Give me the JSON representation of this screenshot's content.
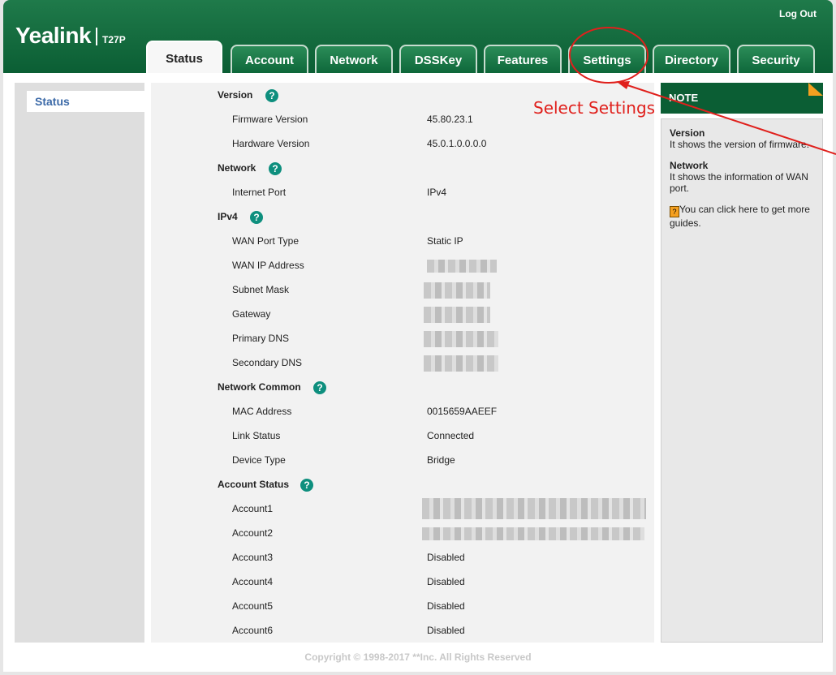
{
  "header": {
    "logout": "Log Out",
    "logo": "Yealink",
    "model": "T27P"
  },
  "tabs": [
    {
      "label": "Status",
      "active": true
    },
    {
      "label": "Account"
    },
    {
      "label": "Network"
    },
    {
      "label": "DSSKey"
    },
    {
      "label": "Features"
    },
    {
      "label": "Settings"
    },
    {
      "label": "Directory"
    },
    {
      "label": "Security"
    }
  ],
  "sidebar": {
    "items": [
      {
        "label": "Status"
      }
    ]
  },
  "main": {
    "version": {
      "title": "Version",
      "firmware_label": "Firmware Version",
      "firmware_value": "45.80.23.1",
      "hardware_label": "Hardware Version",
      "hardware_value": "45.0.1.0.0.0.0"
    },
    "network": {
      "title": "Network",
      "internet_port_label": "Internet Port",
      "internet_port_value": "IPv4"
    },
    "ipv4": {
      "title": "IPv4",
      "wan_type_label": "WAN Port Type",
      "wan_type_value": "Static IP",
      "wan_ip_label": "WAN IP Address",
      "subnet_label": "Subnet Mask",
      "gateway_label": "Gateway",
      "primary_dns_label": "Primary DNS",
      "secondary_dns_label": "Secondary DNS"
    },
    "network_common": {
      "title": "Network Common",
      "mac_label": "MAC Address",
      "mac_value": "0015659AAEEF",
      "link_label": "Link Status",
      "link_value": "Connected",
      "device_label": "Device Type",
      "device_value": "Bridge"
    },
    "account_status": {
      "title": "Account Status",
      "accounts": [
        {
          "label": "Account1",
          "value": ""
        },
        {
          "label": "Account2",
          "value": ""
        },
        {
          "label": "Account3",
          "value": "Disabled"
        },
        {
          "label": "Account4",
          "value": "Disabled"
        },
        {
          "label": "Account5",
          "value": "Disabled"
        },
        {
          "label": "Account6",
          "value": "Disabled"
        }
      ]
    }
  },
  "note": {
    "title": "NOTE",
    "version_title": "Version",
    "version_text": "It shows the version of firmware.",
    "network_title": "Network",
    "network_text": "It shows the information of WAN port.",
    "guide_text": "You can click here to get more guides."
  },
  "footer": "Copyright © 1998-2017 **Inc. All Rights Reserved",
  "annotation": {
    "text": "Select Settings",
    "color": "#e0201c"
  },
  "colors": {
    "header_green": "#0b5e34",
    "accent_orange": "#f5a020",
    "help_teal": "#0e8f7e"
  }
}
